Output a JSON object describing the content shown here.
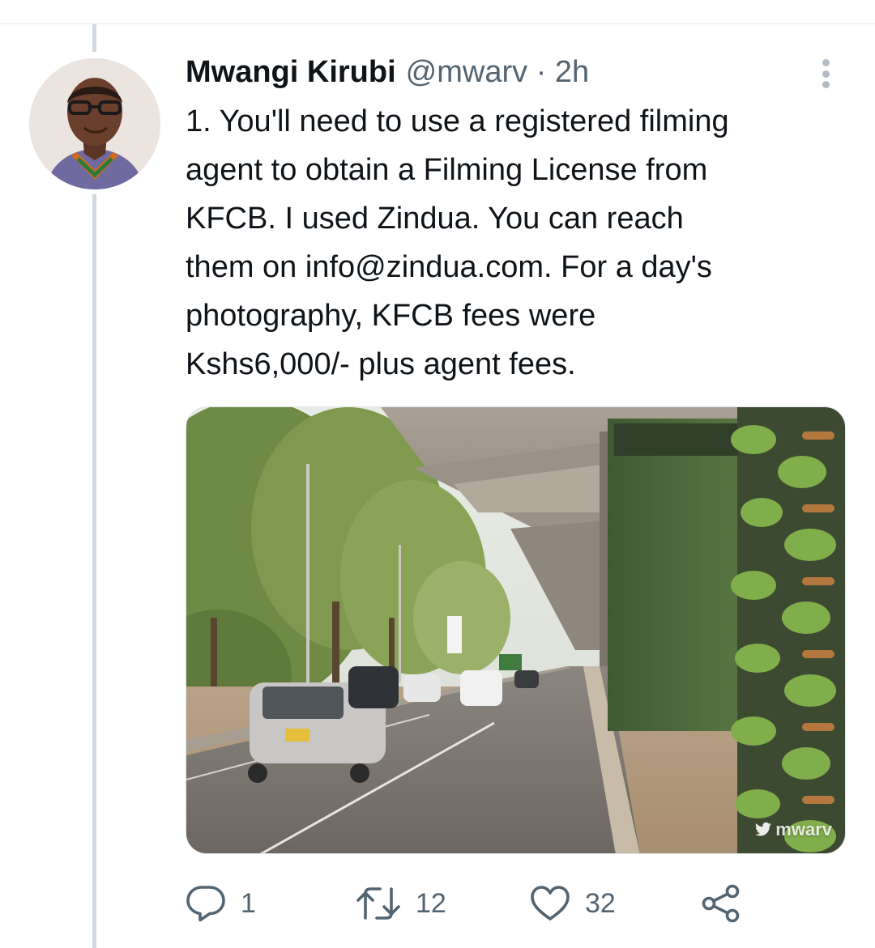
{
  "tweet": {
    "author_name": "Mwangi Kirubi",
    "handle": "@mwarv",
    "separator": "·",
    "time": "2h",
    "text": "1. You'll need to use a registered filming\nagent to obtain a Filming License from\nKFCB. I used Zindua. You can reach\nthem on info@zindua.com. For a day's\nphotography, KFCB fees were\nKshs6,000/- plus agent fees."
  },
  "media": {
    "watermark": "mwarv"
  },
  "actions": {
    "reply_count": "1",
    "retweet_count": "12",
    "like_count": "32"
  },
  "icons": {
    "reply": "reply-icon",
    "retweet": "retweet-icon",
    "like": "heart-icon",
    "share": "share-icon",
    "more": "more-vertical-icon"
  },
  "colors": {
    "text_primary": "#0f1419",
    "text_secondary": "#536471",
    "thread_line": "#cfd9de"
  }
}
